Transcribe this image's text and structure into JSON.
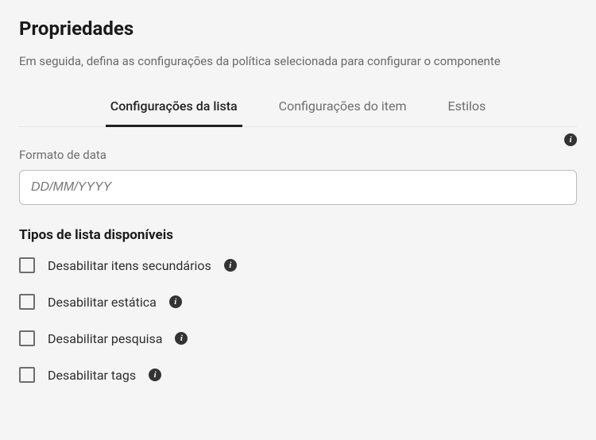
{
  "header": {
    "title": "Propriedades",
    "subtitle": "Em seguida, defina as configurações da política selecionada para configurar o componente"
  },
  "tabs": [
    {
      "label": "Configurações da lista",
      "active": true
    },
    {
      "label": "Configurações do item",
      "active": false
    },
    {
      "label": "Estilos",
      "active": false
    }
  ],
  "dateField": {
    "label": "Formato de data",
    "placeholder": "DD/MM/YYYY"
  },
  "listTypes": {
    "title": "Tipos de lista disponíveis",
    "items": [
      {
        "label": "Desabilitar itens secundários"
      },
      {
        "label": "Desabilitar estática"
      },
      {
        "label": "Desabilitar pesquisa"
      },
      {
        "label": "Desabilitar tags"
      }
    ]
  }
}
